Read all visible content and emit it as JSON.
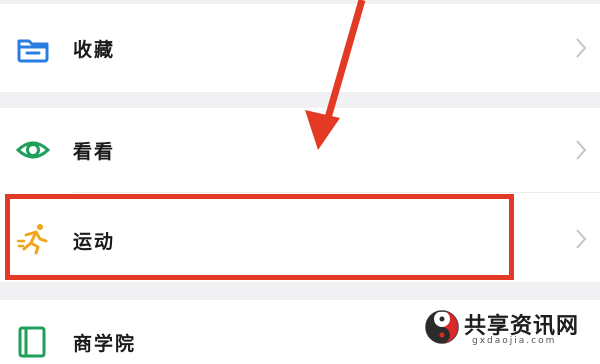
{
  "menu": {
    "items": [
      {
        "label": "收藏",
        "icon": "folder-icon"
      },
      {
        "label": "看看",
        "icon": "eye-icon"
      },
      {
        "label": "运动",
        "icon": "running-icon"
      },
      {
        "label": "商学院",
        "icon": "book-icon"
      }
    ]
  },
  "annotation": {
    "highlight_color": "#e33a25",
    "highlighted_item": "运动"
  },
  "watermark": {
    "title": "共享资讯网",
    "subtitle": "gxdaojia.com"
  },
  "colors": {
    "folder_icon": "#2a7de1",
    "eye_icon": "#1fa05a",
    "running_icon": "#f2a51e",
    "book_icon": "#1fa05a"
  }
}
